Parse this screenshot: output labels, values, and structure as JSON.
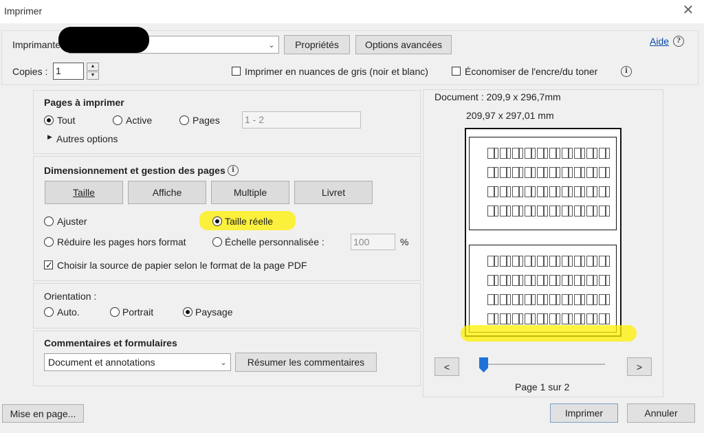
{
  "window": {
    "title": "Imprimer"
  },
  "printer": {
    "label": "Imprimante :",
    "properties_button": "Propriétés",
    "advanced_button": "Options avancées",
    "help_link": "Aide"
  },
  "copies": {
    "label": "Copies :",
    "value": "1",
    "grayscale_label": "Imprimer en nuances de gris (noir et blanc)",
    "grayscale_checked": false,
    "save_ink_label": "Économiser de l'encre/du toner",
    "save_ink_checked": false
  },
  "pages": {
    "title": "Pages à imprimer",
    "options": [
      "Tout",
      "Active",
      "Pages"
    ],
    "selected": "Tout",
    "range_value": "1 - 2",
    "more_options": "Autres options"
  },
  "sizing": {
    "title": "Dimensionnement et gestion des pages",
    "tabs": [
      "Taille",
      "Affiche",
      "Multiple",
      "Livret"
    ],
    "fit_label": "Ajuster",
    "actual_label": "Taille réelle",
    "shrink_label": "Réduire les pages hors format",
    "custom_scale_label": "Échelle personnalisée :",
    "custom_scale_value": "100",
    "percent": "%",
    "selected": "Taille réelle",
    "paper_source_label": "Choisir la source de papier selon le format de la page PDF",
    "paper_source_checked": true
  },
  "orientation": {
    "title": "Orientation :",
    "options": [
      "Auto.",
      "Portrait",
      "Paysage"
    ],
    "selected": "Paysage"
  },
  "comments": {
    "title": "Commentaires et formulaires",
    "select_value": "Document et annotations",
    "summarize_button": "Résumer les commentaires"
  },
  "preview": {
    "document_size": "Document : 209,9 x 296,7mm",
    "paper_size": "209,97 x 297,01 mm",
    "prev_label": "<",
    "next_label": ">",
    "page_info": "Page 1 sur 2",
    "slider_position": 0.0
  },
  "footer": {
    "page_setup_button": "Mise en page...",
    "print_button": "Imprimer",
    "cancel_button": "Annuler"
  },
  "colors": {
    "highlight": "#fff000",
    "link": "#0645ad"
  }
}
